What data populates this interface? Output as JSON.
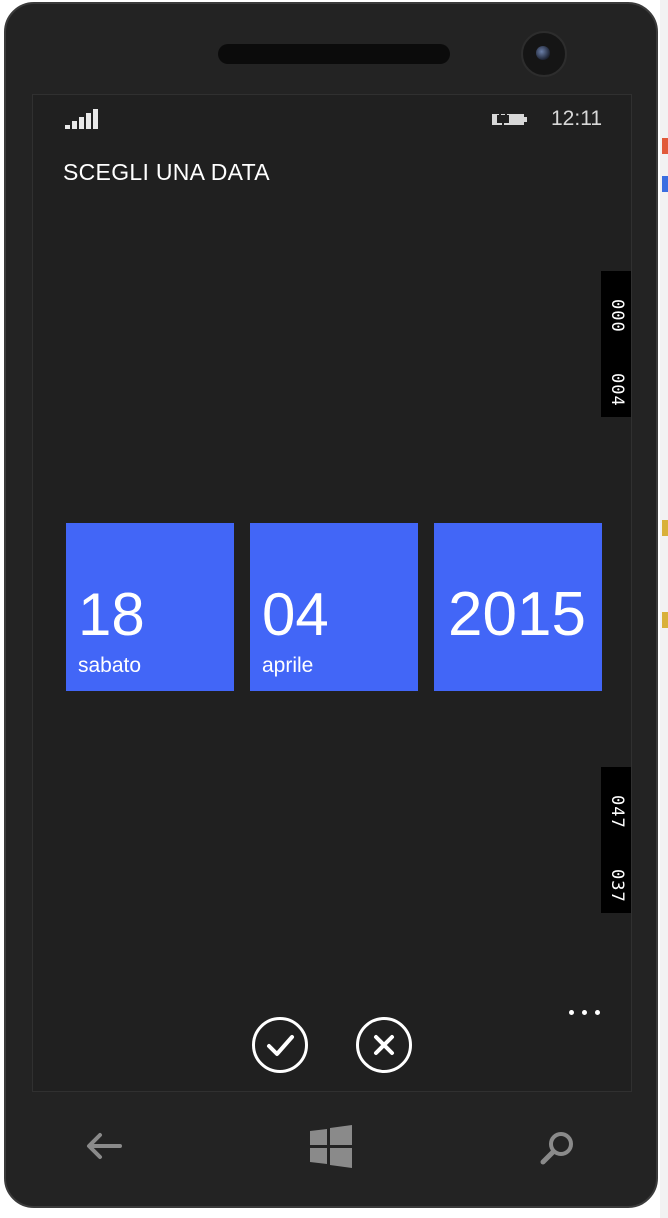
{
  "status_bar": {
    "time": "12:11",
    "signal_icon": "signal-strength-icon",
    "battery_icon": "battery-charging-icon"
  },
  "picker": {
    "title": "SCEGLI UNA DATA",
    "day": {
      "value": "18",
      "label": "sabato"
    },
    "month": {
      "value": "04",
      "label": "aprile"
    },
    "year": {
      "value": "2015"
    },
    "accent_color": "#4266f7"
  },
  "frame_counters": {
    "top": [
      "000",
      "004"
    ],
    "bottom": [
      "047",
      "037"
    ]
  },
  "app_bar": {
    "buttons": [
      {
        "icon": "checkmark-icon"
      },
      {
        "icon": "close-icon"
      }
    ],
    "more_icon": "ellipsis-icon"
  },
  "hardware_buttons": {
    "back_icon": "back-arrow-icon",
    "start_icon": "windows-logo-icon",
    "search_icon": "search-icon"
  }
}
